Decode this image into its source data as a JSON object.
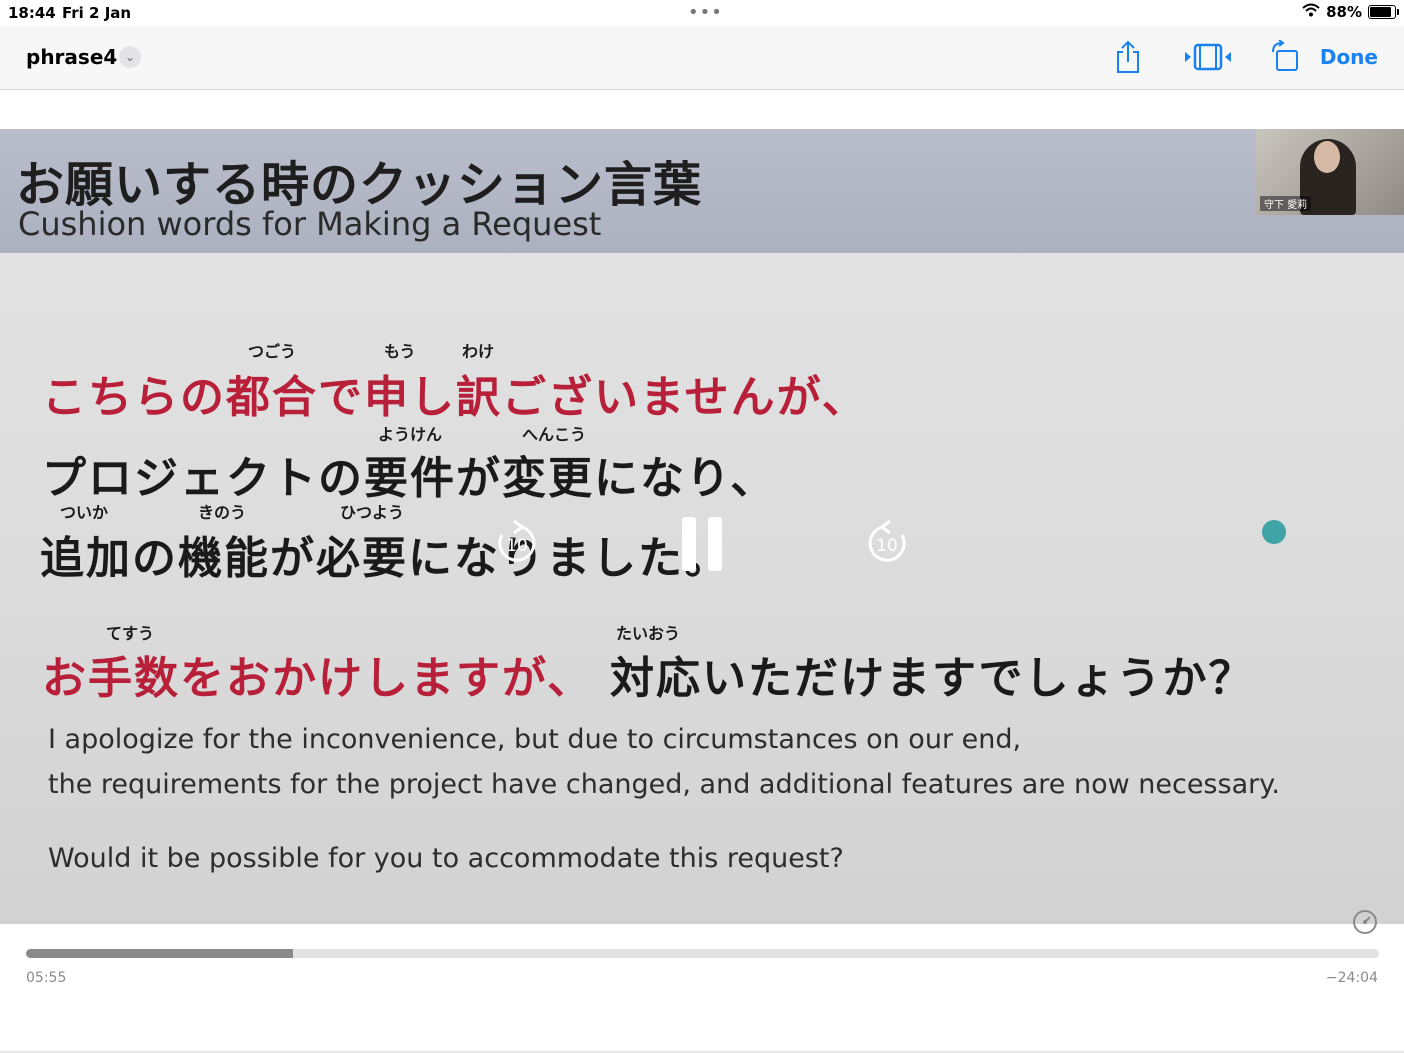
{
  "status_bar": {
    "time": "18:44",
    "date": "Fri 2 Jan",
    "dots": "•••",
    "battery": "88%",
    "battery_level": 0.88
  },
  "nav": {
    "title": "phrase4",
    "done_label": "Done"
  },
  "slide": {
    "title_jp": "お願いする時のクッション言葉",
    "title_en": "Cushion words for Making a Request",
    "camera_name": "守下 愛莉",
    "furigana": {
      "tsugou": "つごう",
      "mou": "もう",
      "wake": "わけ",
      "youken": "ようけん",
      "henkou": "へんこう",
      "tsuika": "ついか",
      "kinou": "きのう",
      "hitsuyou": "ひつよう",
      "tesuu": "てすう",
      "taiou": "たいおう"
    },
    "line1": "こちらの都合で申し訳ございませんが、",
    "line2": "プロジェクトの要件が変更になり、",
    "line3": "追加の機能が必要になりました。",
    "line4_red": "お手数をおかけしますが、",
    "line4_dark": "対応いただけますでしょうか？",
    "en1": "I apologize for the inconvenience, but due to circumstances on our end,",
    "en2": "the requirements for the project have changed, and additional features are now necessary.",
    "en3": "Would it be possible for you to accommodate this request?"
  },
  "controls": {
    "skip_back": "10",
    "skip_forward": "10"
  },
  "playback": {
    "elapsed": "05:55",
    "remaining": "−24:04",
    "progress": 0.197
  },
  "colors": {
    "accent": "#1a82f0",
    "slide_red": "#b81f38"
  }
}
